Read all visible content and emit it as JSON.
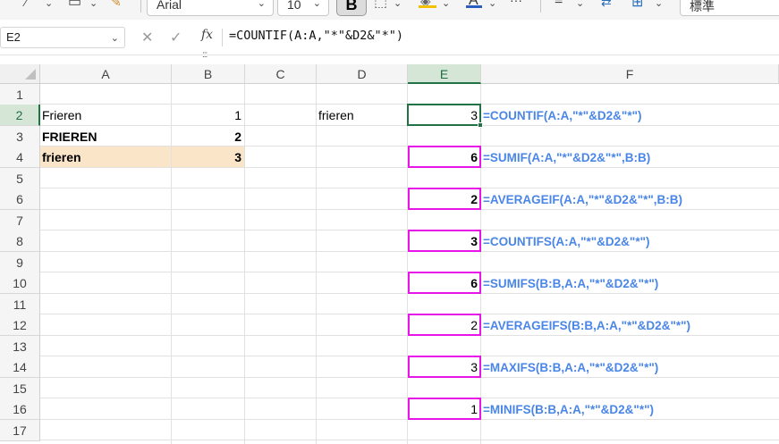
{
  "toolbar": {
    "font_name": "Arial",
    "font_size": "10",
    "bold_label": "B",
    "number_format": "標準",
    "more": "···"
  },
  "formula_bar": {
    "name_box": "E2",
    "fx_label": "fx",
    "formula": "=COUNTIF(A:A,\"*\"&D2&\"*\")",
    "grip": ":::"
  },
  "columns": [
    "A",
    "B",
    "C",
    "D",
    "E",
    "F"
  ],
  "rows": [
    "1",
    "2",
    "3",
    "4",
    "5",
    "6",
    "7",
    "8",
    "9",
    "10",
    "11",
    "12",
    "13",
    "14",
    "15",
    "16",
    "17"
  ],
  "cells": {
    "A2": "Frieren",
    "A3": "FRIEREN",
    "A4": "frieren",
    "B2": "1",
    "B3": "2",
    "B4": "3",
    "D2": "frieren",
    "E2": "3",
    "E4": "6",
    "E6": "2",
    "E8": "3",
    "E10": "6",
    "E12": "2",
    "E14": "3",
    "E16": "1"
  },
  "formula_notes": {
    "F2": "=COUNTIF(A:A,\"*\"&D2&\"*\")",
    "F4": "=SUMIF(A:A,\"*\"&D2&\"*\",B:B)",
    "F6": "=AVERAGEIF(A:A,\"*\"&D2&\"*\",B:B)",
    "F8": "=COUNTIFS(A:A,\"*\"&D2&\"*\")",
    "F10": "=SUMIFS(B:B,A:A,\"*\"&D2&\"*\")",
    "F12": "=AVERAGEIFS(B:B,A:A,\"*\"&D2&\"*\")",
    "F14": "=MAXIFS(B:B,A:A,\"*\"&D2&\"*\")",
    "F16": "=MINIFS(B:B,A:A,\"*\"&D2&\"*\")"
  },
  "selection": {
    "active_cell": "E2",
    "active_row": "2",
    "active_column": "E"
  },
  "colors": {
    "accent_green": "#217346",
    "highlight_box": "#e815e8",
    "note_text": "#4a86e8",
    "row_highlight": "#fbe5c9"
  }
}
